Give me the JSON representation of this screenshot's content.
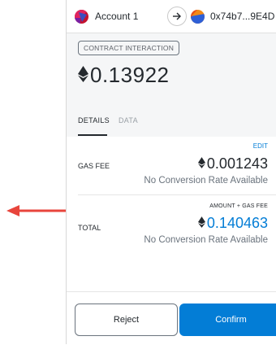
{
  "header": {
    "account_name": "Account 1",
    "to_address": "0x74b7...9E4D"
  },
  "summary": {
    "badge": "CONTRACT INTERACTION",
    "amount": "0.13922"
  },
  "tabs": [
    {
      "label": "DETAILS",
      "active": true
    },
    {
      "label": "DATA",
      "active": false
    }
  ],
  "details": {
    "edit_label": "EDIT",
    "gas_fee_label": "GAS FEE",
    "gas_fee_value": "0.001243",
    "gas_fee_conversion": "No Conversion Rate Available",
    "total_caption": "AMOUNT + GAS FEE",
    "total_label": "TOTAL",
    "total_value": "0.140463",
    "total_conversion": "No Conversion Rate Available"
  },
  "footer": {
    "reject_label": "Reject",
    "confirm_label": "Confirm"
  },
  "colors": {
    "accent": "#037dd6",
    "annotation_arrow": "#e8453c"
  },
  "icons": [
    "left-arrow-annotation-icon",
    "account-identicon",
    "arrow-right-icon",
    "recipient-identicon",
    "eth-diamond-icon"
  ]
}
